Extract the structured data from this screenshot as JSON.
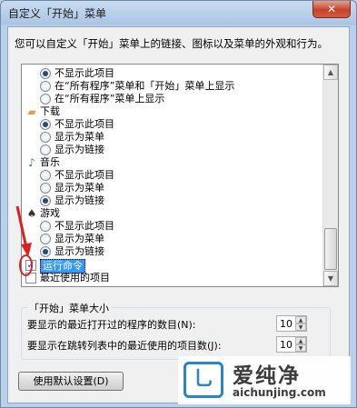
{
  "window": {
    "title": "自定义「开始」菜单",
    "close_glyph": "✕"
  },
  "description": "您可以自定义「开始」菜单上的链接、图标以及菜单的外观和行为。",
  "list": {
    "r1": "不显示此项目",
    "r2": "在“所有程序”菜单和「开始」菜单上显示",
    "r3": "在“所有程序”菜单上显示",
    "cat_download": "下载",
    "d1": "不显示此项目",
    "d2": "显示为菜单",
    "d3": "显示为链接",
    "cat_music": "音乐",
    "m1": "不显示此项目",
    "m2": "显示为菜单",
    "m3": "显示为链接",
    "cat_games": "游戏",
    "g1": "不显示此项目",
    "g2": "显示为菜单",
    "g3": "显示为链接",
    "run": "运行命令",
    "recent": "最近使用的项目",
    "run_checked": true,
    "recent_checked": false
  },
  "size_group": {
    "title": "「开始」菜单大小",
    "line1": "要显示的最近打开过的程序的数目(N):",
    "value1": "10",
    "line2": "要显示在跳转列表中的最近使用的项目数(J):",
    "value2": "10"
  },
  "default_button": "使用默认设置(D)",
  "watermark": {
    "icon_glyph": "乚",
    "title": "爱纯净",
    "url": "aichunjing.com"
  },
  "icons": {
    "download": "folder-download-icon",
    "music": "music-note-icon",
    "games": "games-icon"
  },
  "colors": {
    "selection": "#3399ff",
    "annotation": "#e02020",
    "watermark": "#2a85c8"
  }
}
